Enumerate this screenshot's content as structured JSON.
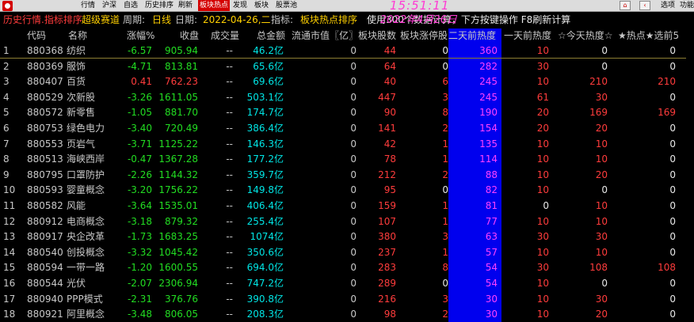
{
  "menu": {
    "items": [
      "行情",
      "沪深",
      "自选",
      "历史排序",
      "刷新",
      "板块热点",
      "发现",
      "板块",
      "股票池"
    ],
    "active_index": 5,
    "right_items": [
      "选项",
      "功能"
    ]
  },
  "clock": {
    "time": "15:51:11",
    "date": "2022年4月26日"
  },
  "info": {
    "mode": "历史行情.指标排序",
    "mode2": "超级赛道",
    "period_label": "周期:",
    "period_value": "日线",
    "date_label": "日期:",
    "date_value": "2022-04-26,二",
    "indicator_label": "指标:",
    "indicator_value": "板块热点排序",
    "note": "使用300个数据计算，下方按键操作 F8刷新计算"
  },
  "table": {
    "headers": [
      "代码",
      "名称",
      "涨幅%",
      "收盘",
      "成交量",
      "总金额",
      "流通市值〖亿〗",
      "板块股数",
      "板块涨停股",
      "二天前热度",
      "一天前热度",
      "☆今天热度☆",
      "★热点★选前5"
    ],
    "rows": [
      {
        "idx": "1",
        "code": "880368",
        "name": "纺织",
        "chg": "-6.57",
        "price": "905.94",
        "vol": "--",
        "amt": "46.2亿",
        "mcap": "0",
        "cnt": "44",
        "lim": "0",
        "heat2": "360",
        "heat1": "10",
        "heat0": "0",
        "hot5": "0"
      },
      {
        "idx": "2",
        "code": "880369",
        "name": "服饰",
        "chg": "-4.71",
        "price": "813.81",
        "vol": "--",
        "amt": "65.6亿",
        "mcap": "0",
        "cnt": "64",
        "lim": "0",
        "heat2": "282",
        "heat1": "30",
        "heat0": "0",
        "hot5": "0"
      },
      {
        "idx": "3",
        "code": "880407",
        "name": "百货",
        "chg": "0.41",
        "price": "762.23",
        "vol": "--",
        "amt": "69.6亿",
        "mcap": "0",
        "cnt": "40",
        "lim": "6",
        "heat2": "245",
        "heat1": "10",
        "heat0": "210",
        "hot5": "210"
      },
      {
        "idx": "4",
        "code": "880529",
        "name": "次新股",
        "chg": "-3.26",
        "price": "1611.05",
        "vol": "--",
        "amt": "503.1亿",
        "mcap": "0",
        "cnt": "447",
        "lim": "3",
        "heat2": "245",
        "heat1": "61",
        "heat0": "30",
        "hot5": "0"
      },
      {
        "idx": "5",
        "code": "880572",
        "name": "新零售",
        "chg": "-1.05",
        "price": "881.70",
        "vol": "--",
        "amt": "174.7亿",
        "mcap": "0",
        "cnt": "90",
        "lim": "8",
        "heat2": "190",
        "heat1": "20",
        "heat0": "169",
        "hot5": "169"
      },
      {
        "idx": "6",
        "code": "880753",
        "name": "绿色电力",
        "chg": "-3.40",
        "price": "720.49",
        "vol": "--",
        "amt": "386.4亿",
        "mcap": "0",
        "cnt": "141",
        "lim": "2",
        "heat2": "154",
        "heat1": "20",
        "heat0": "20",
        "hot5": "0"
      },
      {
        "idx": "7",
        "code": "880553",
        "name": "页岩气",
        "chg": "-3.71",
        "price": "1125.22",
        "vol": "--",
        "amt": "146.3亿",
        "mcap": "0",
        "cnt": "42",
        "lim": "1",
        "heat2": "135",
        "heat1": "10",
        "heat0": "10",
        "hot5": "0"
      },
      {
        "idx": "8",
        "code": "880513",
        "name": "海峡西岸",
        "chg": "-0.47",
        "price": "1367.28",
        "vol": "--",
        "amt": "177.2亿",
        "mcap": "0",
        "cnt": "78",
        "lim": "1",
        "heat2": "114",
        "heat1": "10",
        "heat0": "10",
        "hot5": "0"
      },
      {
        "idx": "9",
        "code": "880795",
        "name": "口罩防护",
        "chg": "-2.26",
        "price": "1144.32",
        "vol": "--",
        "amt": "359.7亿",
        "mcap": "0",
        "cnt": "212",
        "lim": "2",
        "heat2": "88",
        "heat1": "10",
        "heat0": "20",
        "hot5": "0"
      },
      {
        "idx": "10",
        "code": "880593",
        "name": "婴童概念",
        "chg": "-3.20",
        "price": "1756.22",
        "vol": "--",
        "amt": "149.8亿",
        "mcap": "0",
        "cnt": "95",
        "lim": "0",
        "heat2": "82",
        "heat1": "10",
        "heat0": "0",
        "hot5": "0"
      },
      {
        "idx": "11",
        "code": "880582",
        "name": "风能",
        "chg": "-3.64",
        "price": "1535.01",
        "vol": "--",
        "amt": "406.4亿",
        "mcap": "0",
        "cnt": "159",
        "lim": "1",
        "heat2": "81",
        "heat1": "0",
        "heat0": "10",
        "hot5": "0"
      },
      {
        "idx": "12",
        "code": "880912",
        "name": "电商概念",
        "chg": "-3.18",
        "price": "879.32",
        "vol": "--",
        "amt": "255.4亿",
        "mcap": "0",
        "cnt": "107",
        "lim": "1",
        "heat2": "77",
        "heat1": "10",
        "heat0": "10",
        "hot5": "0"
      },
      {
        "idx": "13",
        "code": "880917",
        "name": "央企改革",
        "chg": "-1.73",
        "price": "1683.25",
        "vol": "--",
        "amt": "1074亿",
        "mcap": "0",
        "cnt": "380",
        "lim": "3",
        "heat2": "63",
        "heat1": "30",
        "heat0": "30",
        "hot5": "0"
      },
      {
        "idx": "14",
        "code": "880540",
        "name": "创投概念",
        "chg": "-3.32",
        "price": "1045.42",
        "vol": "--",
        "amt": "350.6亿",
        "mcap": "0",
        "cnt": "237",
        "lim": "1",
        "heat2": "57",
        "heat1": "10",
        "heat0": "10",
        "hot5": "0"
      },
      {
        "idx": "15",
        "code": "880594",
        "name": "一带一路",
        "chg": "-1.20",
        "price": "1600.55",
        "vol": "--",
        "amt": "694.0亿",
        "mcap": "0",
        "cnt": "283",
        "lim": "8",
        "heat2": "54",
        "heat1": "30",
        "heat0": "108",
        "hot5": "108"
      },
      {
        "idx": "16",
        "code": "880544",
        "name": "光伏",
        "chg": "-2.07",
        "price": "2306.94",
        "vol": "--",
        "amt": "747.2亿",
        "mcap": "0",
        "cnt": "289",
        "lim": "0",
        "heat2": "54",
        "heat1": "10",
        "heat0": "0",
        "hot5": "0"
      },
      {
        "idx": "17",
        "code": "880940",
        "name": "PPP模式",
        "chg": "-2.31",
        "price": "376.76",
        "vol": "--",
        "amt": "390.8亿",
        "mcap": "0",
        "cnt": "216",
        "lim": "3",
        "heat2": "30",
        "heat1": "10",
        "heat0": "30",
        "hot5": "0"
      },
      {
        "idx": "18",
        "code": "880921",
        "name": "阿里概念",
        "chg": "-3.48",
        "price": "806.05",
        "vol": "--",
        "amt": "208.3亿",
        "mcap": "0",
        "cnt": "98",
        "lim": "2",
        "heat2": "30",
        "heat1": "10",
        "heat0": "20",
        "hot5": "0"
      }
    ]
  },
  "colors": {
    "up": "#ff3c3c",
    "down": "#22dd22",
    "amount": "#00e5e5",
    "highlight_column": "#0000ee",
    "heat2_text": "#ff40ff",
    "clock": "#ff3bd4",
    "menu_active": "#d40000"
  }
}
